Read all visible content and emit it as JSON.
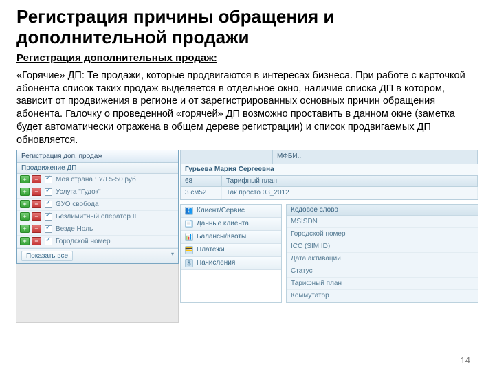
{
  "title": "Регистрация причины обращения и дополнительной продажи",
  "subtitle": "Регистрация дополнительных продаж:",
  "paragraph": "«Горячие» ДП: Те продажи, которые продвигаются в интересах бизнеса. При работе с карточкой абонента список таких продаж выделяется в отдельное окно, наличие списка ДП в котором, зависит от продвижения в регионе и от зарегистрированных основных причин обращения абонента. Галочку о проведенной «горячей» ДП возможно проставить в данном окне (заметка будет автоматически отражена в общем дереве регистрации) и список продвигаемых ДП обновляется.",
  "page_number": "14",
  "left_window": {
    "title": "Регистрация доп. продаж",
    "grid_header": "Продвижение ДП",
    "rows": [
      "Моя страна : УЛ 5-50 руб",
      "Услуга \"Гудок\"",
      "GУО свобода",
      "Безлимитный оператор II",
      "Везде Ноль",
      "Городской номер"
    ],
    "footer_show_all": "Показать все",
    "footer_arrow": "▾"
  },
  "right_panel": {
    "tabs": [
      "",
      "",
      "МФБИ..."
    ],
    "name_strip": "Гурьева Мария Сергеевна",
    "detail_head_left": "68",
    "detail_head_right": "Тарифный план",
    "detail_cell_left": "3 см52",
    "detail_cell_right": "Так просто 03_2012",
    "accordion": [
      {
        "icon": "👥",
        "label": "Клиент/Сервис"
      },
      {
        "icon": "📄",
        "label": "Данные клиента"
      },
      {
        "icon": "📊",
        "label": "Балансы/Квоты"
      },
      {
        "icon": "💳",
        "label": "Платежи"
      },
      {
        "icon": "$",
        "label": "Начисления"
      }
    ],
    "info_head": "Кодовое слово",
    "info_rows": [
      "MSISDN",
      "Городской номер",
      "ICC (SIM ID)",
      "Дата активации",
      "Статус",
      "Тарифный план",
      "Коммутатор"
    ]
  }
}
